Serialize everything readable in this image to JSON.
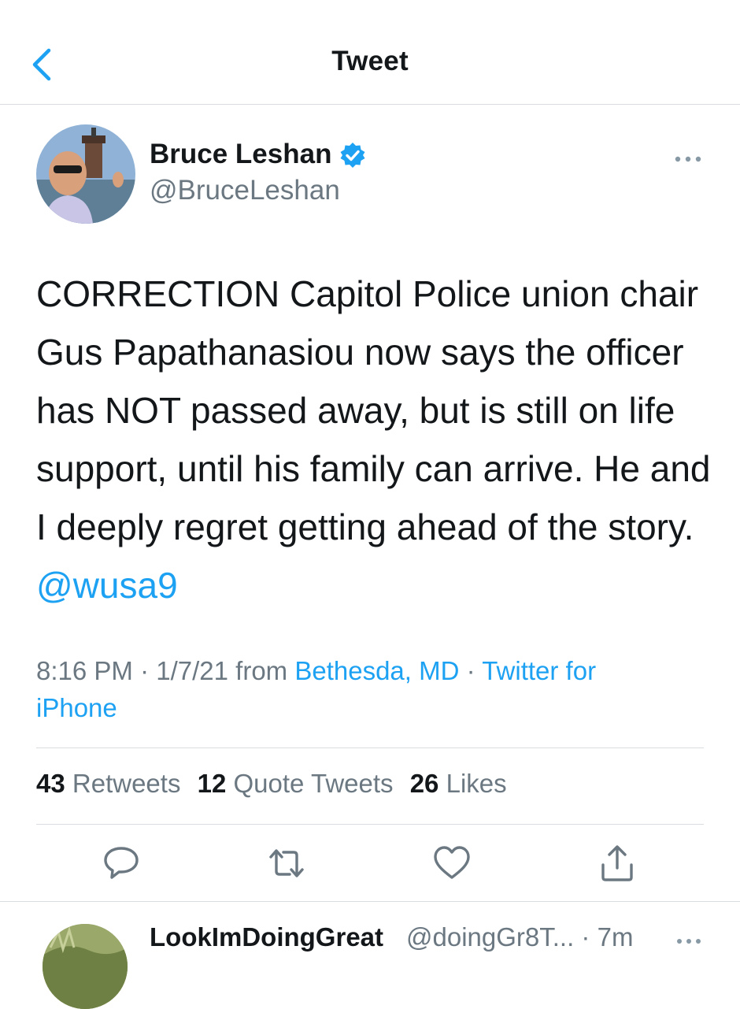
{
  "header": {
    "title": "Tweet"
  },
  "tweet": {
    "author_name": "Bruce Leshan",
    "author_handle": "@BruceLeshan",
    "text_main": "CORRECTION Capitol Police union chair Gus Papathanasiou now says the officer has NOT passed away, but is still on life support, until his family can arrive. He and I deeply regret getting ahead of the story.",
    "mention": "@wusa9",
    "time": "8:16 PM",
    "date": "1/7/21",
    "from_label": "from",
    "location": "Bethesda, MD",
    "client": "Twitter for iPhone",
    "stats": {
      "retweets_count": "43",
      "retweets_label": "Retweets",
      "quotes_count": "12",
      "quotes_label": "Quote Tweets",
      "likes_count": "26",
      "likes_label": "Likes"
    }
  },
  "reply": {
    "name": "LookImDoingGreat",
    "handle": "@doingGr8T...",
    "time": "7m"
  },
  "colors": {
    "accent": "#1da1f2",
    "text": "#14171a",
    "secondary": "#6b7882",
    "divider": "#d9dde1"
  },
  "icons": [
    "back-chevron-icon",
    "verified-badge-icon",
    "more-options-icon",
    "reply-icon",
    "retweet-icon",
    "like-icon",
    "share-icon"
  ]
}
